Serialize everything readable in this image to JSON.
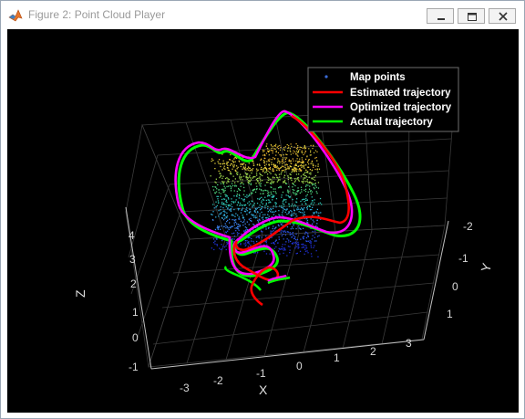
{
  "window": {
    "title": "Figure 2: Point Cloud Player",
    "icon": "matlab-icon",
    "controls": [
      "minimize-icon",
      "maximize-icon",
      "close-icon"
    ]
  },
  "legend": {
    "items": [
      {
        "label": "Map points",
        "style": "dots",
        "color": "#3a6bd6"
      },
      {
        "label": "Estimated trajectory",
        "style": "line",
        "color": "#ff0000"
      },
      {
        "label": "Optimized trajectory",
        "style": "line",
        "color": "#ff00ff"
      },
      {
        "label": "Actual trajectory",
        "style": "line",
        "color": "#00ff00"
      }
    ]
  },
  "axes": {
    "xlabel": "X",
    "ylabel": "Y",
    "zlabel": "Z",
    "x_ticks": [
      "-3",
      "-2",
      "-1",
      "0",
      "1",
      "2",
      "3"
    ],
    "y_ticks": [
      "-2",
      "-1",
      "0",
      "1"
    ],
    "z_ticks": [
      "4",
      "3",
      "2",
      "1",
      "0",
      "-1"
    ],
    "grid": true,
    "background": "#000000",
    "axis_color": "#bfbfbf"
  }
}
